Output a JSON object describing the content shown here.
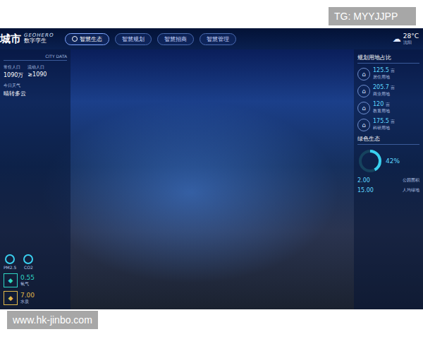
{
  "watermarks": {
    "top": "TG: MYYJJPP",
    "bottom": "www.hk-jinbo.com"
  },
  "header": {
    "title": "城市",
    "brand": "GEOHERO",
    "subtitle": "数字孪生",
    "weather": {
      "temp": "28°C",
      "city": "沈阳"
    }
  },
  "tabs": [
    {
      "label": "智慧生态",
      "selected": true
    },
    {
      "label": "智慧规划",
      "selected": false
    },
    {
      "label": "智慧招商",
      "selected": false
    },
    {
      "label": "智慧管理",
      "selected": false
    }
  ],
  "left_panel": {
    "title": "CITY DATA",
    "stats": [
      {
        "label": "常住人口",
        "value": "1090万"
      },
      {
        "label": "流动人口",
        "value": "≥1090"
      }
    ],
    "weather": {
      "label": "今日天气",
      "value": "晴转多云"
    },
    "metrics": [
      {
        "label": "PM2.5"
      },
      {
        "label": "CO2"
      }
    ],
    "indicators": [
      {
        "value": "0.55",
        "label": "氧气",
        "color": "#2fd6c4"
      },
      {
        "value": "7.00",
        "label": "水质",
        "color": "#e0b84a"
      }
    ]
  },
  "right_panel": {
    "title": "规划用地占比",
    "items": [
      {
        "value": "125.5",
        "unit": "亩",
        "label": "居住用地"
      },
      {
        "value": "205.7",
        "unit": "亩",
        "label": "商业用地"
      },
      {
        "value": "120",
        "unit": "亩",
        "label": "教育用地"
      },
      {
        "value": "175.5",
        "unit": "亩",
        "label": "科研用地"
      }
    ],
    "eco": {
      "title": "绿色生态",
      "reading": "42%",
      "level": 0.42,
      "rows": [
        {
          "value": "2.00",
          "label": "公园面积"
        },
        {
          "value": "15.00",
          "label": "人均绿地"
        }
      ]
    }
  }
}
